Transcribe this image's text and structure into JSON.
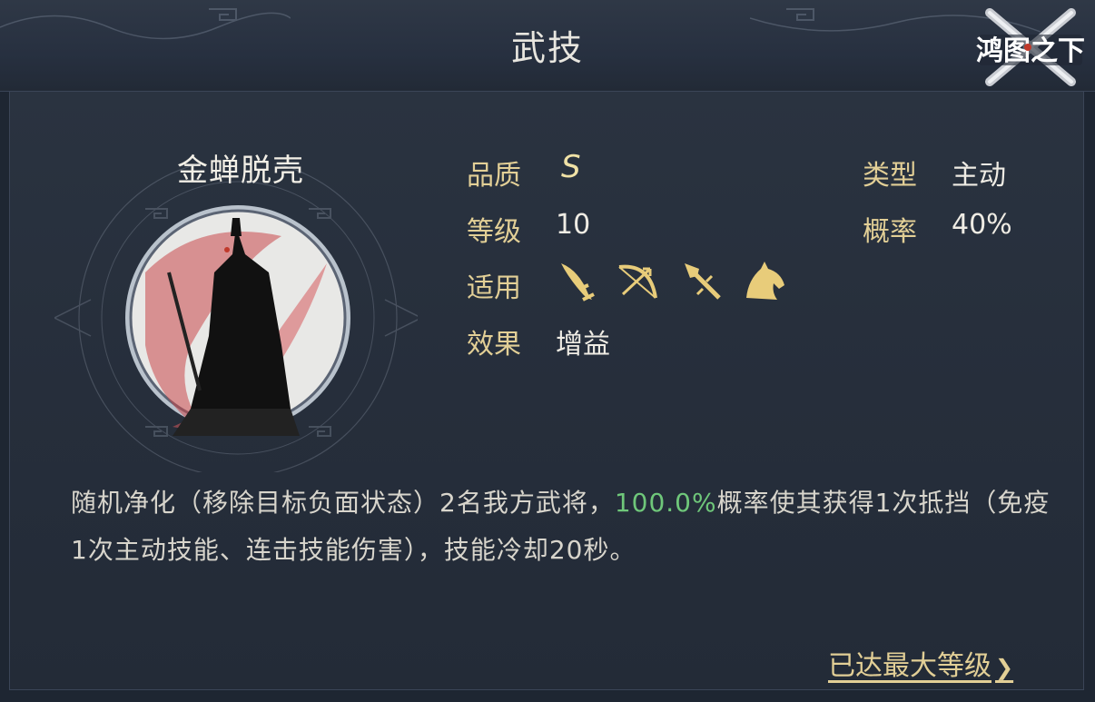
{
  "header": {
    "title": "武技"
  },
  "logo": {
    "text": "鸿图之下",
    "icon": "game-logo"
  },
  "skill": {
    "name": "金蝉脱壳",
    "portrait_icon": "cloaked-general-portrait"
  },
  "attributes": {
    "quality_label": "品质",
    "quality_value": "S",
    "level_label": "等级",
    "level_value": "10",
    "applicable_label": "适用",
    "effect_label": "效果",
    "effect_value": "增益",
    "type_label": "类型",
    "type_value": "主动",
    "chance_label": "概率",
    "chance_value": "40%"
  },
  "applicable_icons": [
    "sword-icon",
    "bow-icon",
    "spear-icon",
    "horse-icon"
  ],
  "description": {
    "part1": "随机净化（移除目标负面状态）2名我方武将，",
    "highlight": "100.0%",
    "part2": "概率使其获得1次抵挡（免疫1次主动技能、连击技能伤害），技能冷却20秒。"
  },
  "footer": {
    "max_level_link": "已达最大等级",
    "arrow": "❯"
  },
  "colors": {
    "background": "#1e2632",
    "label_gold": "#e2cf96",
    "highlight_green": "#6fc77a",
    "text_light": "#efece4"
  }
}
